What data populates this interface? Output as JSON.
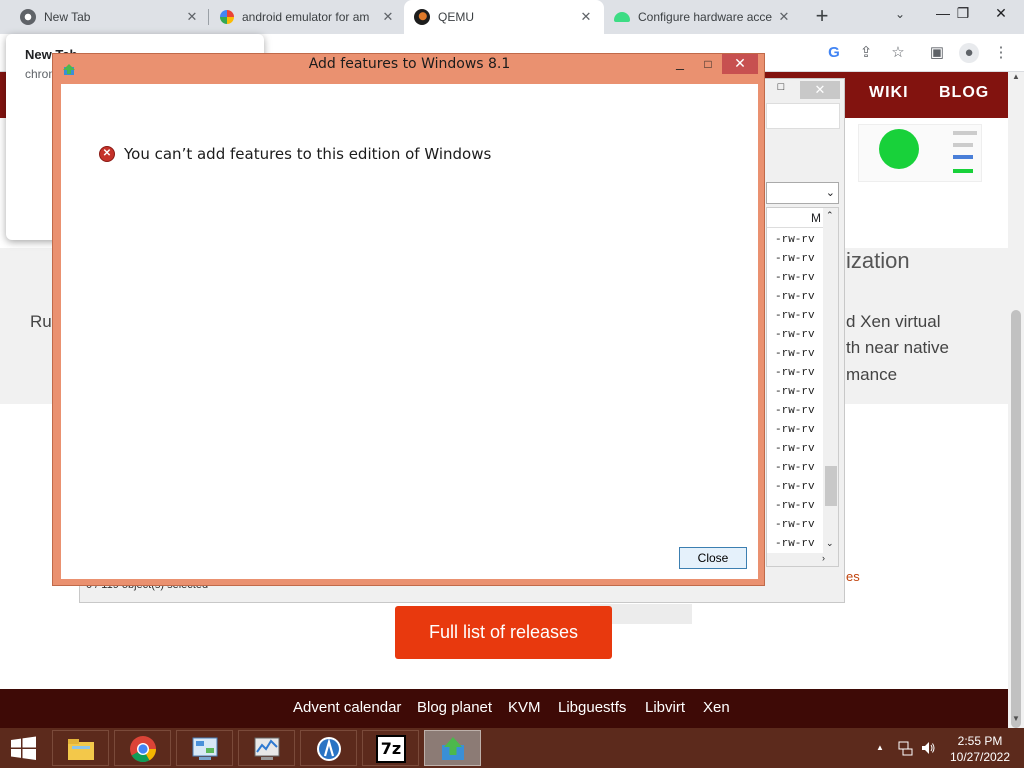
{
  "browser": {
    "tabs": [
      {
        "title": "New Tab",
        "favicon": "chrome-icon",
        "active": false
      },
      {
        "title": "android emulator for am",
        "favicon": "google-icon",
        "active": false
      },
      {
        "title": "QEMU",
        "favicon": "qemu-icon",
        "active": true
      },
      {
        "title": "Configure hardware acce",
        "favicon": "android-icon",
        "active": false
      }
    ],
    "new_tab_symbol": "+",
    "tab_search_symbol": "⌄",
    "window_minimize": "—",
    "window_restore": "❐",
    "window_close": "✕",
    "toolbar_icons": [
      "google-lens-icon",
      "share-icon",
      "bookmark-star-icon",
      "sidebar-icon",
      "profile-icon",
      "menu-icon"
    ]
  },
  "popup": {
    "title": "New Tab",
    "subtitle": "chrome://newtab"
  },
  "site": {
    "nav": {
      "wiki": "WIKI",
      "blog": "BLOG"
    },
    "hero_title": "ization",
    "hero_lines": [
      "d Xen virtual",
      "th near native",
      "mance"
    ],
    "left_fragment": "Ru",
    "releases_link": "es",
    "releases_button": "Full list of releases",
    "footer_links": [
      "Advent calendar",
      "Blog planet",
      "KVM",
      "Libguestfs",
      "Libvirt",
      "Xen"
    ]
  },
  "file_manager": {
    "column_header": "M",
    "rows": [
      "-rw-rv",
      "-rw-rv",
      "-rw-rv",
      "-rw-rv",
      "-rw-rv",
      "-rw-rv",
      "-rw-rv",
      "-rw-rv",
      "-rw-rv",
      "-rw-rv",
      "-rw-rv",
      "-rw-rv",
      "-rw-rv",
      "-rw-rv",
      "-rw-rv",
      "-rw-rv",
      "-rw-rv"
    ],
    "status": "0 / 119 object(s) selected",
    "combo_symbol": "⌄",
    "close_symbol": "✕",
    "max_symbol": "□"
  },
  "dialog": {
    "title": "Add features to Windows 8.1",
    "message": "You can’t add features to this edition of Windows",
    "close_button": "Close",
    "min_symbol": "_",
    "max_symbol": "□",
    "close_symbol": "✕"
  },
  "taskbar": {
    "apps": [
      "file-explorer-icon",
      "chrome-icon",
      "control-panel-icon",
      "resource-monitor-icon",
      "android-studio-icon",
      "7zip-icon",
      "add-features-icon"
    ],
    "seven_zip_label": "7z",
    "clock_time": "2:55 PM",
    "clock_date": "10/27/2022",
    "tray_expand": "▲"
  },
  "colors": {
    "site_header": "#82130f",
    "site_footer": "#3e0a06",
    "releases_button": "#e8390e",
    "dialog_frame": "#ea9170",
    "taskbar": "#5c2a1c"
  }
}
